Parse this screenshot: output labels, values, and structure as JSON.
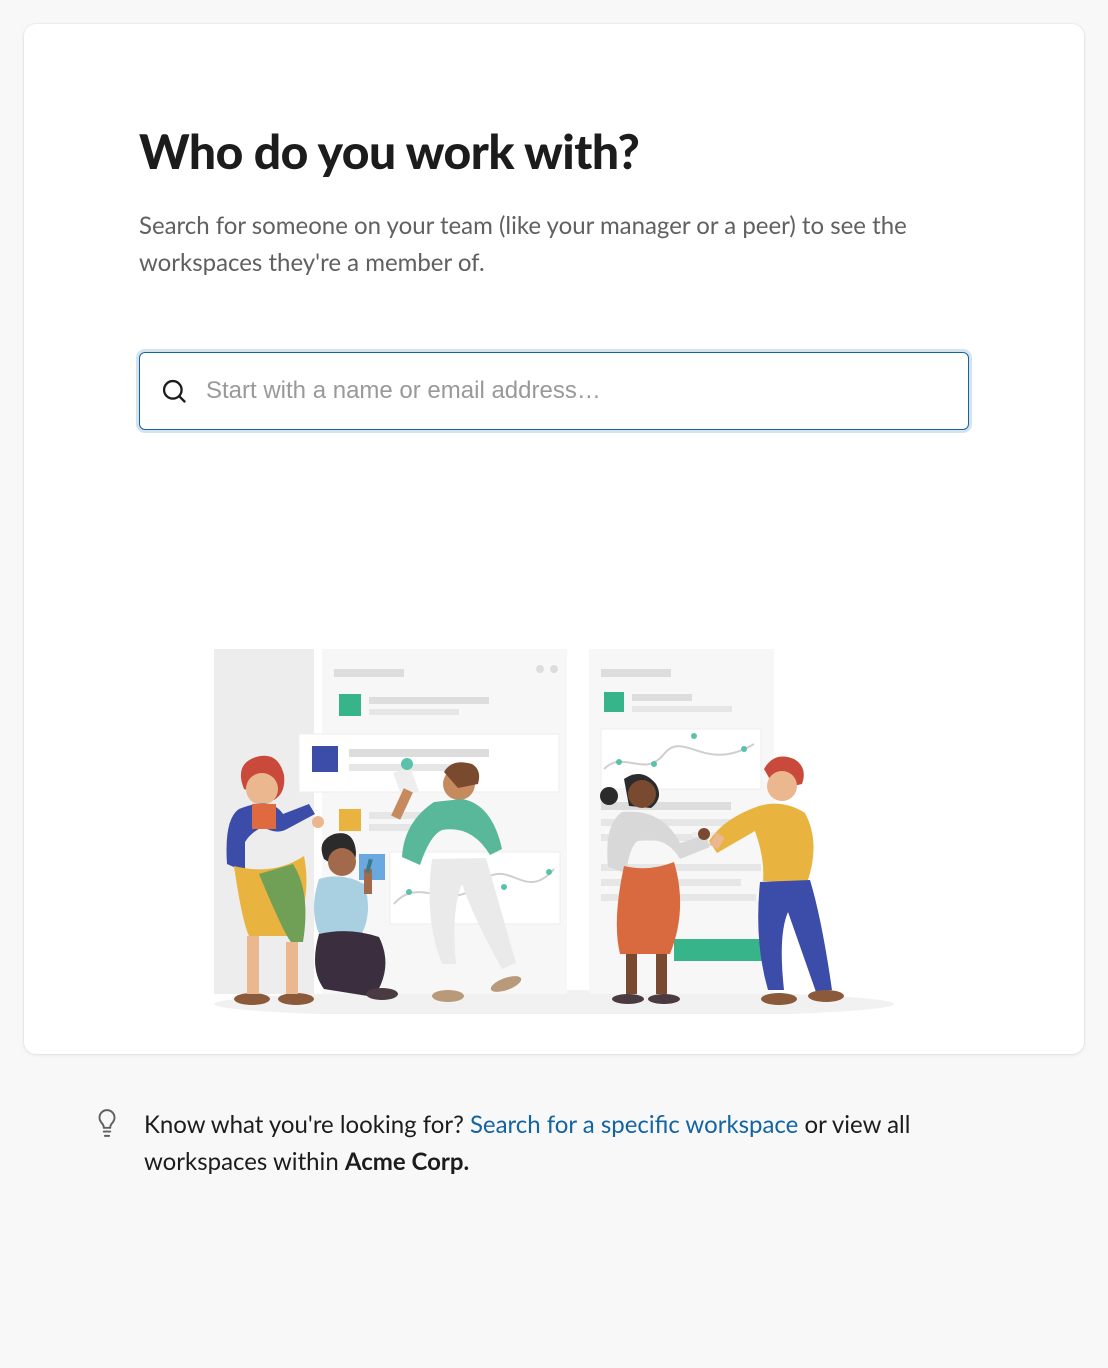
{
  "main": {
    "title": "Who do you work with?",
    "subtitle": "Search for someone on your team (like your manager or a peer) to see the workspaces they're a member of.",
    "search": {
      "placeholder": "Start with a name or email address…",
      "value": ""
    }
  },
  "tip": {
    "prefix": "Know what you're looking for? ",
    "link_text": "Search for a specific workspace",
    "middle": " or view all workspaces within ",
    "org_name": "Acme Corp."
  },
  "icons": {
    "search": "search-icon",
    "lightbulb": "lightbulb-icon"
  },
  "colors": {
    "accent": "#1264a3",
    "text_primary": "#1d1c1d",
    "text_secondary": "#616061",
    "placeholder": "#999999"
  }
}
